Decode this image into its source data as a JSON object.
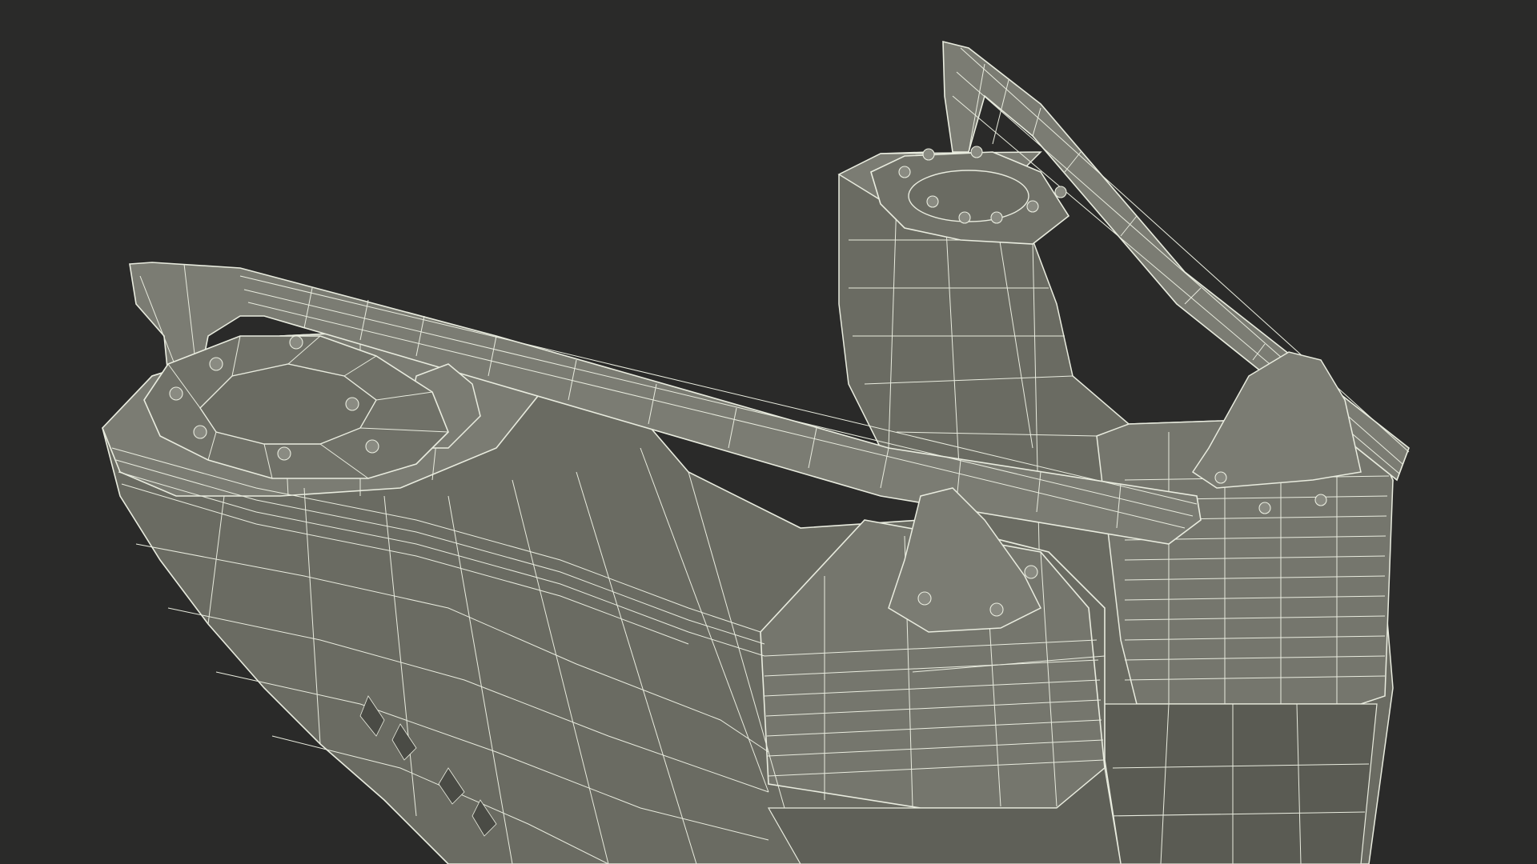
{
  "scene": {
    "subject": "",
    "colors": {
      "background": "#2a2a29",
      "surface": "#6a6b62",
      "surface_light": "#7b7c73",
      "surface_dark": "#55564f",
      "shadow": "#3d3e39",
      "wire": "#e9ecdf"
    }
  }
}
